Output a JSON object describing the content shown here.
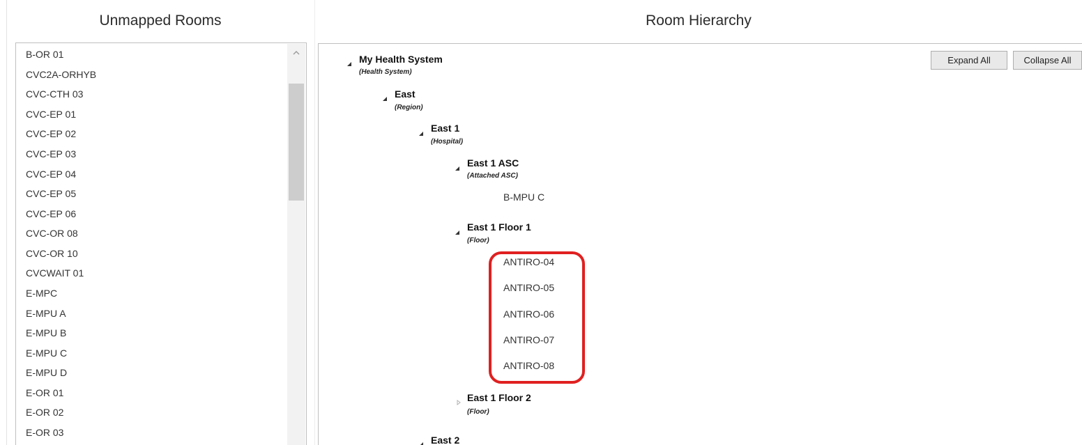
{
  "unmapped": {
    "title": "Unmapped Rooms",
    "rooms": [
      "B-OR 01",
      "CVC2A-ORHYB",
      "CVC-CTH 03",
      "CVC-EP 01",
      "CVC-EP 02",
      "CVC-EP 03",
      "CVC-EP 04",
      "CVC-EP 05",
      "CVC-EP 06",
      "CVC-OR 08",
      "CVC-OR 10",
      "CVCWAIT 01",
      "E-MPC",
      "E-MPU A",
      "E-MPU B",
      "E-MPU C",
      "E-MPU D",
      "E-OR 01",
      "E-OR 02",
      "E-OR 03"
    ]
  },
  "hierarchy": {
    "title": "Room Hierarchy",
    "expand_all": "Expand All",
    "collapse_all": "Collapse All",
    "nodes": {
      "health_system": {
        "name": "My Health System",
        "type": "(Health System)",
        "expanded": true
      },
      "east": {
        "name": "East",
        "type": "(Region)",
        "expanded": true
      },
      "east1": {
        "name": "East 1",
        "type": "(Hospital)",
        "expanded": true
      },
      "east1_asc": {
        "name": "East 1 ASC",
        "type": "(Attached ASC)",
        "expanded": true,
        "rooms": [
          "B-MPU C"
        ]
      },
      "east1_floor1": {
        "name": "East 1 Floor 1",
        "type": "(Floor)",
        "expanded": true,
        "rooms": [
          "ANTIRO-04",
          "ANTIRO-05",
          "ANTIRO-06",
          "ANTIRO-07",
          "ANTIRO-08"
        ]
      },
      "east1_floor2": {
        "name": "East 1 Floor 2",
        "type": "(Floor)",
        "expanded": false
      },
      "east2": {
        "name": "East 2"
      }
    }
  },
  "colors": {
    "highlight": "#e02020",
    "border": "#bfbfbf",
    "button_bg": "#e9e9e9"
  },
  "icons": {
    "expanded": "expanded-triangle-icon",
    "collapsed": "collapsed-triangle-icon",
    "scroll_up": "chevron-up-icon"
  }
}
